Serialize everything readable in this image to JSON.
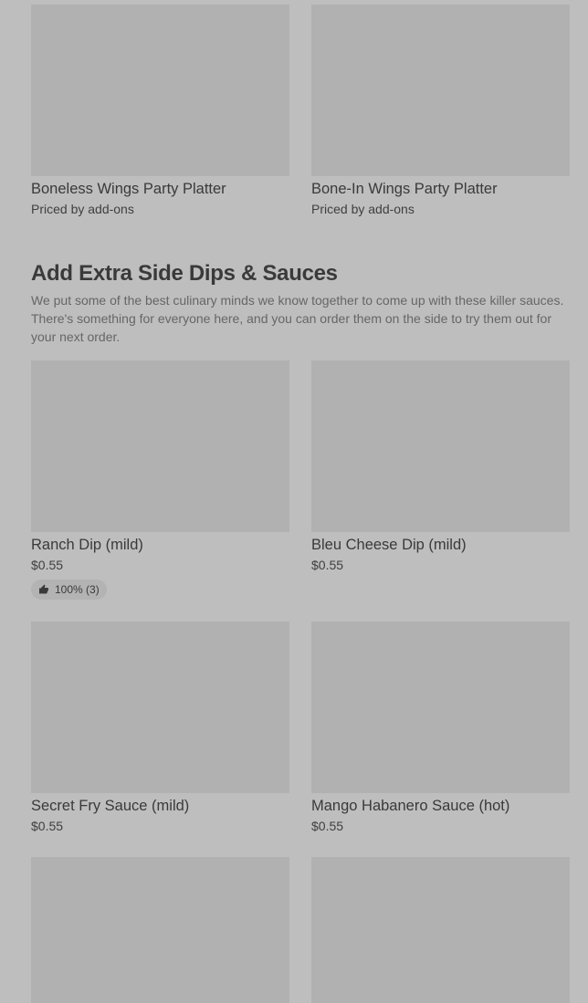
{
  "platters": [
    {
      "name": "Boneless Wings Party Platter",
      "price": "Priced by add-ons"
    },
    {
      "name": "Bone-In Wings Party Platter",
      "price": "Priced by add-ons"
    }
  ],
  "section": {
    "title": "Add Extra Side Dips & Sauces",
    "description": "We put some of the best culinary minds we know together to come up with these killer sauces. There's something for everyone here, and you can order them on the side to try them out for your next order."
  },
  "dips_row1": [
    {
      "name": "Ranch Dip (mild)",
      "price": "$0.55",
      "rating": "100% (3)",
      "rating_icon": "thumbs-up-icon"
    },
    {
      "name": "Bleu Cheese Dip (mild)",
      "price": "$0.55"
    }
  ],
  "dips_row2": [
    {
      "name": "Secret Fry Sauce (mild)",
      "price": "$0.55"
    },
    {
      "name": "Mango Habanero Sauce (hot)",
      "price": "$0.55"
    }
  ],
  "colors": {
    "background": "#bebebe",
    "placeholder": "#b1b1b1",
    "text": "#3a3a3a"
  }
}
